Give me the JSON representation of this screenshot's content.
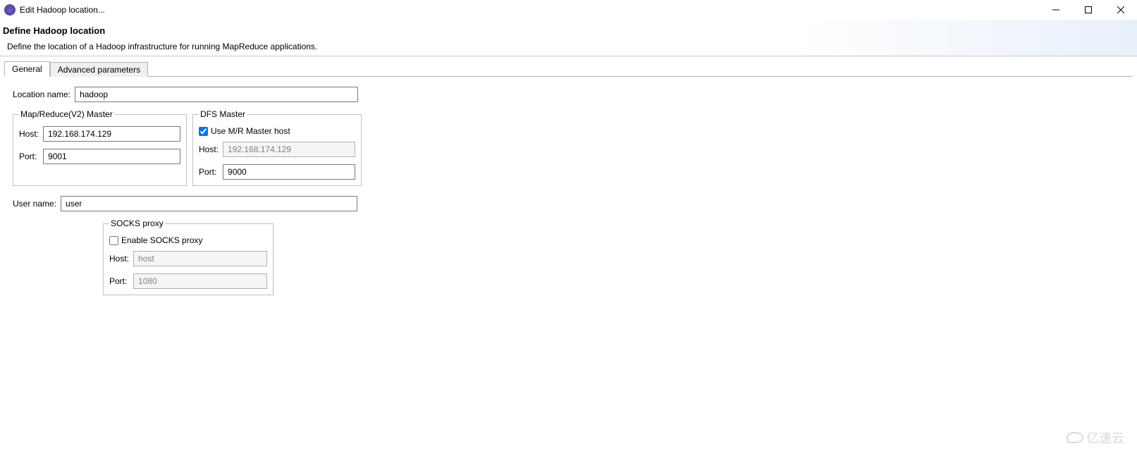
{
  "window": {
    "title": "Edit Hadoop location..."
  },
  "header": {
    "title": "Define Hadoop location",
    "description": "Define the location of a Hadoop infrastructure for running MapReduce applications."
  },
  "tabs": {
    "general_label": "General",
    "advanced_label": "Advanced parameters"
  },
  "form": {
    "location_name_label": "Location name:",
    "location_name_value": "hadoop",
    "mr_master": {
      "legend": "Map/Reduce(V2) Master",
      "host_label": "Host:",
      "host_value": "192.168.174.129",
      "port_label": "Port:",
      "port_value": "9001"
    },
    "dfs_master": {
      "legend": "DFS Master",
      "use_mr_host_label": "Use M/R Master host",
      "use_mr_host_checked": true,
      "host_label": "Host:",
      "host_value": "192.168.174.129",
      "port_label": "Port:",
      "port_value": "9000"
    },
    "user_name_label": "User name:",
    "user_name_value": "user",
    "socks": {
      "legend": "SOCKS proxy",
      "enable_label": "Enable SOCKS proxy",
      "enable_checked": false,
      "host_label": "Host:",
      "host_value": "host",
      "port_label": "Port:",
      "port_value": "1080"
    }
  },
  "watermark": {
    "text": "亿速云"
  }
}
